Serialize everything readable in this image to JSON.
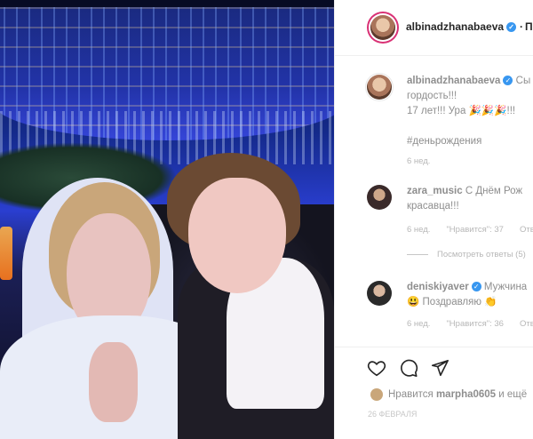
{
  "post": {
    "author": "albinadzhanabaeva",
    "follow_label": "П"
  },
  "caption": {
    "author": "albinadzhanabaeva",
    "text_line1": "Сы",
    "text_line2": "гордость!!!",
    "text_line3": "17 лет!!! Ура",
    "text_line3_end": "!!!",
    "hashtag": "#деньрождения",
    "time": "6 нед."
  },
  "comments": [
    {
      "author": "zara_music",
      "text_line1": "С Днём Рож",
      "text_line2": "красавца!!!",
      "time": "6 нед.",
      "likes": "\"Нравится\": 37",
      "reply": "Ответ",
      "view_replies": "Посмотреть ответы (5)"
    },
    {
      "author": "deniskiyaver",
      "text_line1": "Мужчина",
      "text_line2": "Поздравляю",
      "time": "6 нед.",
      "likes": "\"Нравится\": 36",
      "reply": "Ответ"
    }
  ],
  "footer": {
    "likes_prefix": "Нравится",
    "likes_user": "marpha0605",
    "likes_suffix": "и ещё",
    "date": "26 февраля"
  },
  "icons": {
    "heart": "heart-icon",
    "comment": "comment-icon",
    "share": "share-icon",
    "verified": "verified-badge-icon"
  },
  "colors": {
    "story_ring": "#d93175",
    "verified": "#3897f0"
  }
}
